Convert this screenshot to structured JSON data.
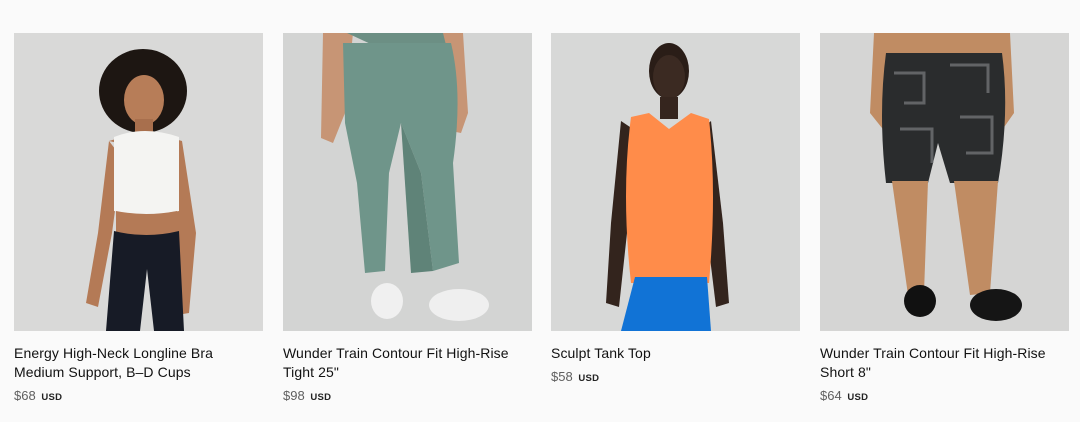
{
  "products": [
    {
      "title_line1": "Energy High-Neck Longline Bra",
      "title_line2": "Medium Support, B–D Cups",
      "price": "$68",
      "currency": "USD",
      "image_desc": "model-white-sports-bra-black-leggings"
    },
    {
      "title_line1": "Wunder Train Contour Fit High-Rise",
      "title_line2": "Tight 25\"",
      "price": "$98",
      "currency": "USD",
      "image_desc": "model-sage-green-leggings-white-sneakers"
    },
    {
      "title_line1": "Sculpt Tank Top",
      "title_line2": "",
      "price": "$58",
      "currency": "USD",
      "image_desc": "model-orange-tank-blue-leggings"
    },
    {
      "title_line1": "Wunder Train Contour Fit High-Rise",
      "title_line2": "Short 8\"",
      "price": "$64",
      "currency": "USD",
      "image_desc": "model-printed-black-shorts-black-sneakers"
    }
  ],
  "colors": {
    "page_bg": "#fafafa",
    "image_bg": "#d8d8d7",
    "title": "#111111",
    "price": "#5f5f5f"
  }
}
